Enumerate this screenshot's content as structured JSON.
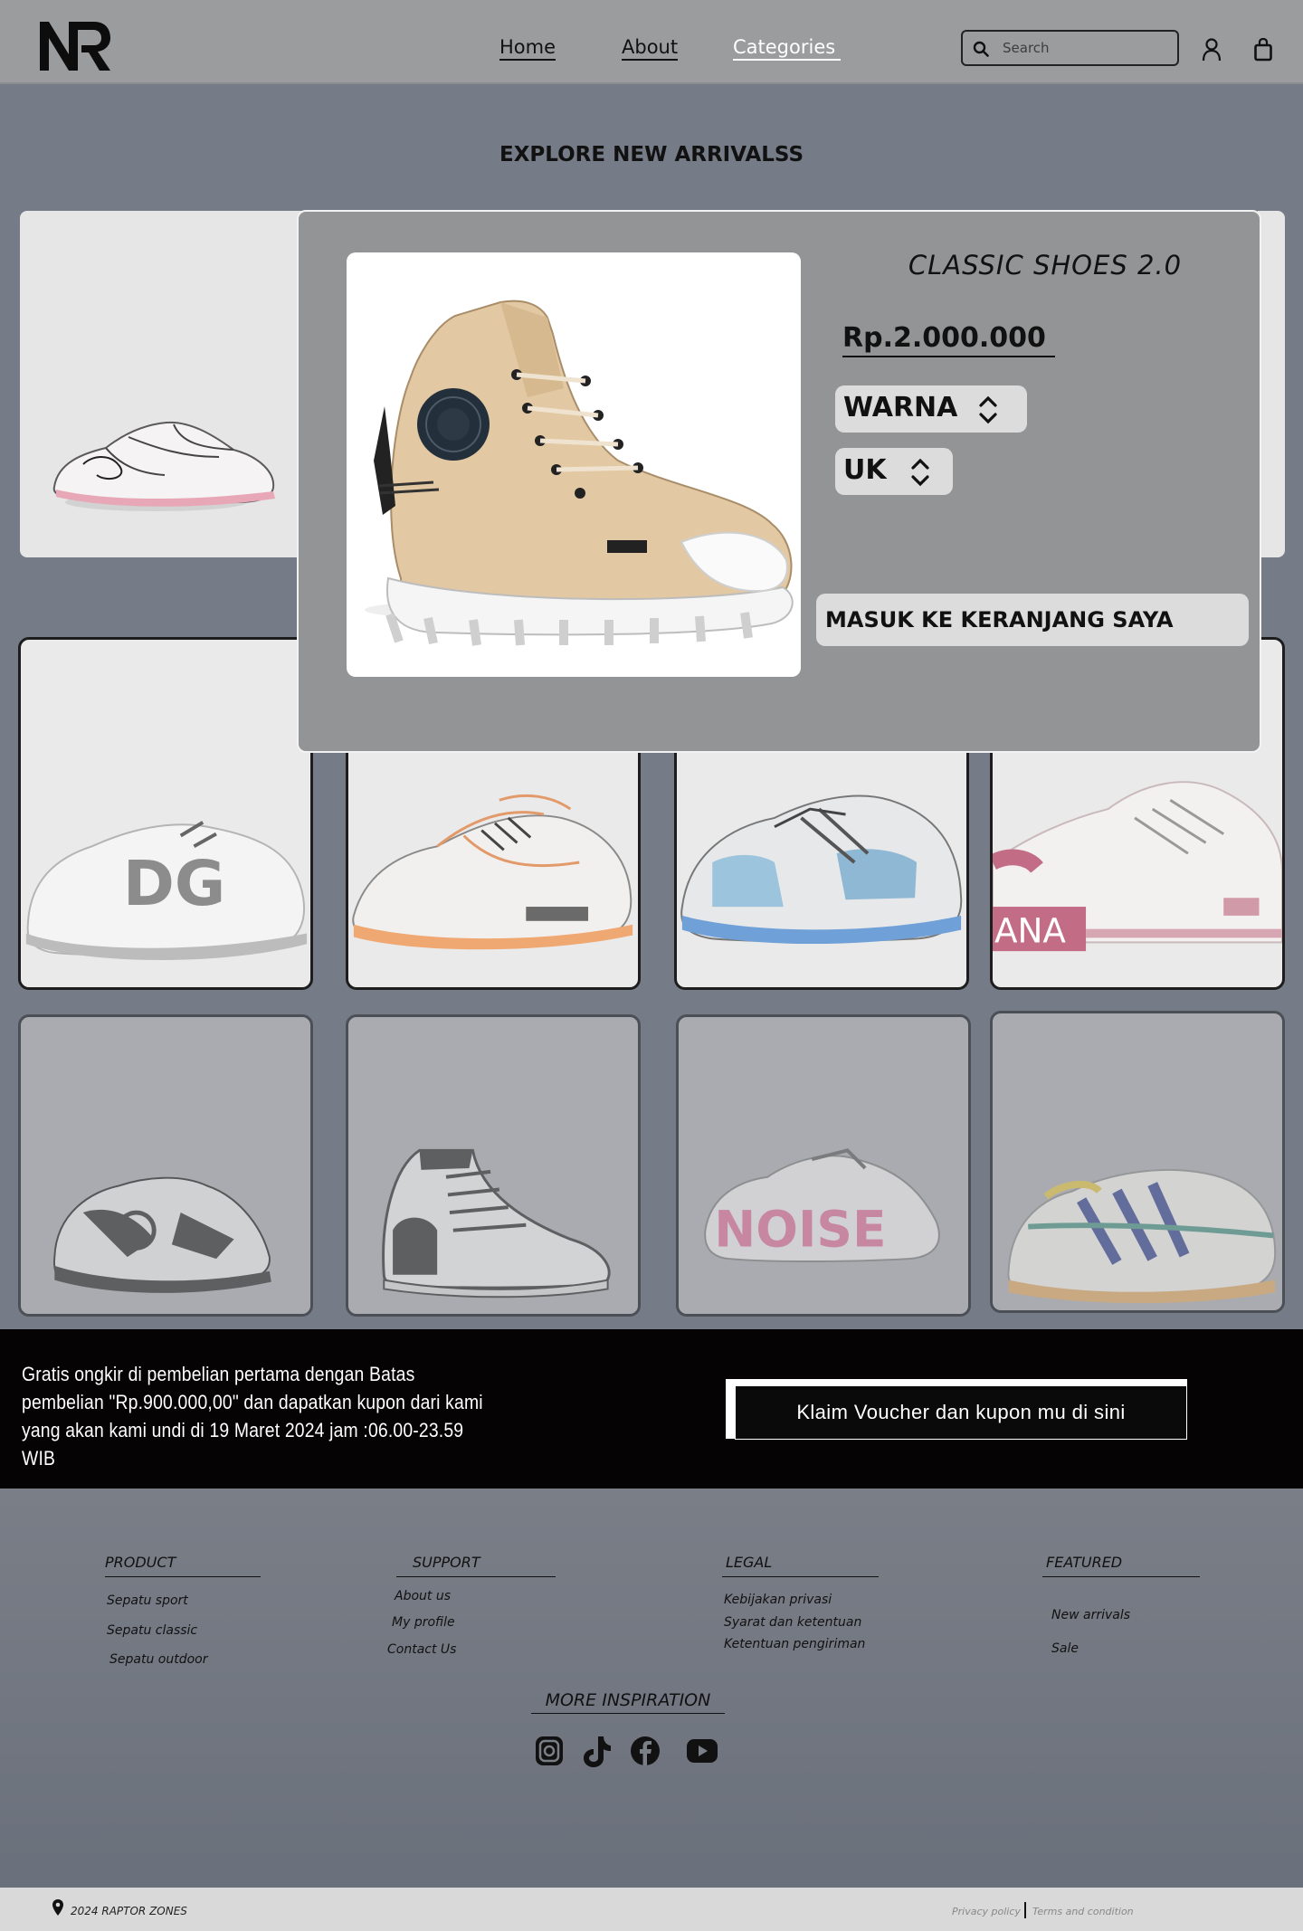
{
  "header": {
    "logo": "NR",
    "nav": [
      {
        "label": "Home",
        "active": false
      },
      {
        "label": "About",
        "active": false
      },
      {
        "label": "Categories",
        "active": true
      }
    ],
    "search_placeholder": "Search",
    "icons": [
      "search-icon",
      "user-icon",
      "shopping-bag-icon"
    ]
  },
  "page_title": "EXPLORE NEW ARRIVALSS",
  "modal": {
    "title": "CLASSIC SHOES 2.0",
    "price": "Rp.2.000.000",
    "color_label": "WARNA",
    "size_label": "UK",
    "cart_button": "MASUK KE KERANJANG SAYA"
  },
  "promo": {
    "text": "Gratis ongkir di pembelian pertama dengan Batas pembelian \"Rp.900.000,00\" dan dapatkan kupon dari kami yang akan kami undi di 19 Maret 2024 jam :06.00-23.59 WIB",
    "button": "Klaim Voucher dan kupon mu di sini"
  },
  "footer": {
    "columns": [
      {
        "heading": "PRODUCT",
        "links": [
          "Sepatu sport",
          "Sepatu classic",
          "Sepatu outdoor"
        ]
      },
      {
        "heading": "SUPPORT",
        "links": [
          "About us",
          "My profile",
          "Contact Us"
        ]
      },
      {
        "heading": "LEGAL",
        "links": [
          "Kebijakan privasi",
          "Syarat dan ketentuan",
          "Ketentuan pengiriman"
        ]
      },
      {
        "heading": "FEATURED",
        "links": [
          "New arrivals",
          "Sale"
        ]
      }
    ],
    "more_inspiration": "MORE INSPIRATION",
    "social_icons": [
      "instagram-icon",
      "tiktok-icon",
      "facebook-icon",
      "youtube-icon"
    ]
  },
  "bottom_bar": {
    "copyright": "2024 RAPTOR ZONES",
    "privacy": "Privacy policy",
    "terms": "Terms and condition"
  },
  "colors": {
    "page_bg": "#767c87",
    "header_bg": "#9b9c9e",
    "modal_bg": "#939495",
    "promo_bg": "#060304",
    "bottom_bar_bg": "#d9d9d9"
  }
}
